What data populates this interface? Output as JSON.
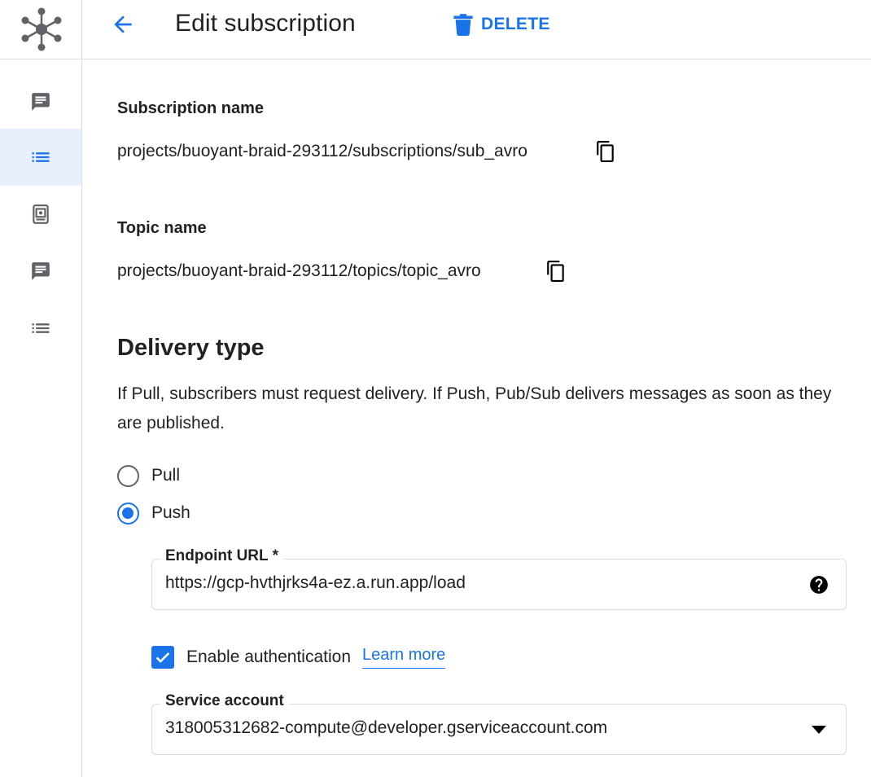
{
  "header": {
    "title": "Edit subscription",
    "delete_label": "DELETE"
  },
  "rail": {
    "items": [
      {
        "icon": "chat-icon",
        "active": false
      },
      {
        "icon": "list-icon",
        "active": true
      },
      {
        "icon": "snapshot-icon",
        "active": false
      },
      {
        "icon": "chat-icon",
        "active": false
      },
      {
        "icon": "list-icon",
        "active": false
      }
    ]
  },
  "subscription": {
    "label": "Subscription name",
    "value": "projects/buoyant-braid-293112/subscriptions/sub_avro"
  },
  "topic": {
    "label": "Topic name",
    "value": "projects/buoyant-braid-293112/topics/topic_avro"
  },
  "delivery": {
    "title": "Delivery type",
    "description": "If Pull, subscribers must request delivery. If Push, Pub/Sub delivers messages as soon as they are published.",
    "options": [
      {
        "label": "Pull",
        "selected": false
      },
      {
        "label": "Push",
        "selected": true
      }
    ],
    "endpoint": {
      "label": "Endpoint URL *",
      "value": "https://gcp-hvthjrks4a-ez.a.run.app/load"
    },
    "auth": {
      "label": "Enable authentication",
      "checked": true,
      "link": "Learn more"
    },
    "service_account": {
      "label": "Service account",
      "value": "318005312682-compute@developer.gserviceaccount.com"
    }
  },
  "colors": {
    "accent": "#1a73e8",
    "text": "#202124",
    "icon": "#5f6368",
    "divider": "#dadce0",
    "active_bg": "#e8f0fe"
  }
}
